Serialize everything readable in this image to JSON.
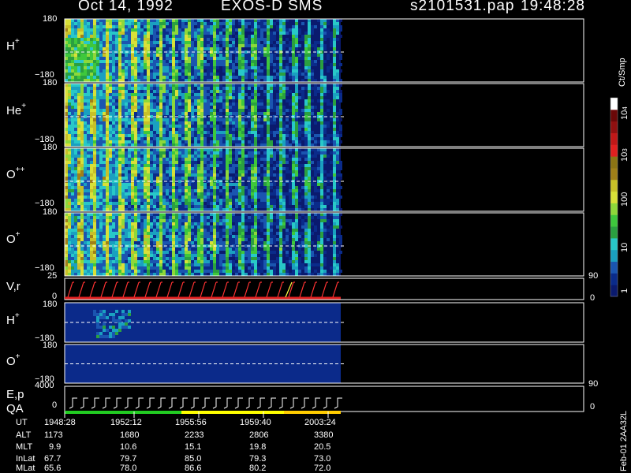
{
  "header": {
    "date": "Oct 14, 1992",
    "mission": "EXOS-D SMS",
    "file": "s2101531.pap",
    "time": "19:48:28"
  },
  "colorbar": {
    "unit": "Ct/Smp",
    "tick_values": [
      1,
      10,
      100,
      1000,
      10000
    ],
    "tick_labels": {
      "t1": "1",
      "t10": "10",
      "t100": "100",
      "t1000": "10",
      "t1000_exp": "3",
      "t10000": "10",
      "t10000_exp": "4"
    },
    "colors": [
      "#0a1a6e",
      "#0a2b8a",
      "#1a55b0",
      "#1aa0c0",
      "#28c8c8",
      "#2aa040",
      "#3ec83c",
      "#8ed83a",
      "#d8e038",
      "#c8c028",
      "#a08018",
      "#8c7414",
      "#e02020",
      "#c01818",
      "#901010",
      "#6a0808",
      "#ffffff"
    ]
  },
  "side_note": "Feb-01 2AA32L",
  "chart_data": {
    "type": "heatmap",
    "x_time_labels": [
      "1948:28",
      "1952:12",
      "1955:56",
      "1959:40",
      "2003:24"
    ],
    "spectrogram_panels": [
      {
        "name": "H",
        "charge": "+",
        "ylim": [
          -180,
          180
        ],
        "ytick_top": "180",
        "ytick_bottom": "−180"
      },
      {
        "name": "He",
        "charge": "+",
        "ylim": [
          -180,
          180
        ],
        "ytick_top": "180",
        "ytick_bottom": "−180"
      },
      {
        "name": "O",
        "charge": "++",
        "ylim": [
          -180,
          180
        ],
        "ytick_top": "180",
        "ytick_bottom": "−180"
      },
      {
        "name": "O",
        "charge": "+",
        "ylim": [
          -180,
          180
        ],
        "ytick_top": "180",
        "ytick_bottom": "−180"
      }
    ],
    "vr_panel": {
      "label": "V,r",
      "ytick_top": "25",
      "ytick_bottom": "0",
      "right_top": "90",
      "right_bottom": "0"
    },
    "secondary_panels": [
      {
        "name": "H",
        "charge": "+",
        "ytick_top": "180",
        "ytick_bottom": "−180"
      },
      {
        "name": "O",
        "charge": "+",
        "ytick_top": "180",
        "ytick_bottom": "−180"
      }
    ],
    "ep_panel": {
      "label": "E,p",
      "qa_label": "QA",
      "ytick_top": "4000",
      "ytick_bottom": "0",
      "right_top": "90",
      "right_bottom": "0"
    },
    "qa_colors": [
      "#22cc22",
      "#ffff00",
      "#ffcc00"
    ]
  },
  "table": {
    "rows": [
      {
        "label": "UT",
        "values": [
          "1948:28",
          "1952:12",
          "1955:56",
          "1959:40",
          "2003:24"
        ]
      },
      {
        "label": "ALT",
        "values": [
          "1173",
          "1680",
          "2233",
          "2806",
          "3380"
        ]
      },
      {
        "label": "MLT",
        "values": [
          "9.9",
          "10.6",
          "15.1",
          "19.8",
          "20.5"
        ]
      },
      {
        "label": "InLat",
        "values": [
          "67.7",
          "79.7",
          "85.0",
          "79.3",
          "73.0"
        ]
      },
      {
        "label": "MLat",
        "values": [
          "65.6",
          "78.0",
          "86.6",
          "80.2",
          "72.0"
        ]
      }
    ]
  }
}
